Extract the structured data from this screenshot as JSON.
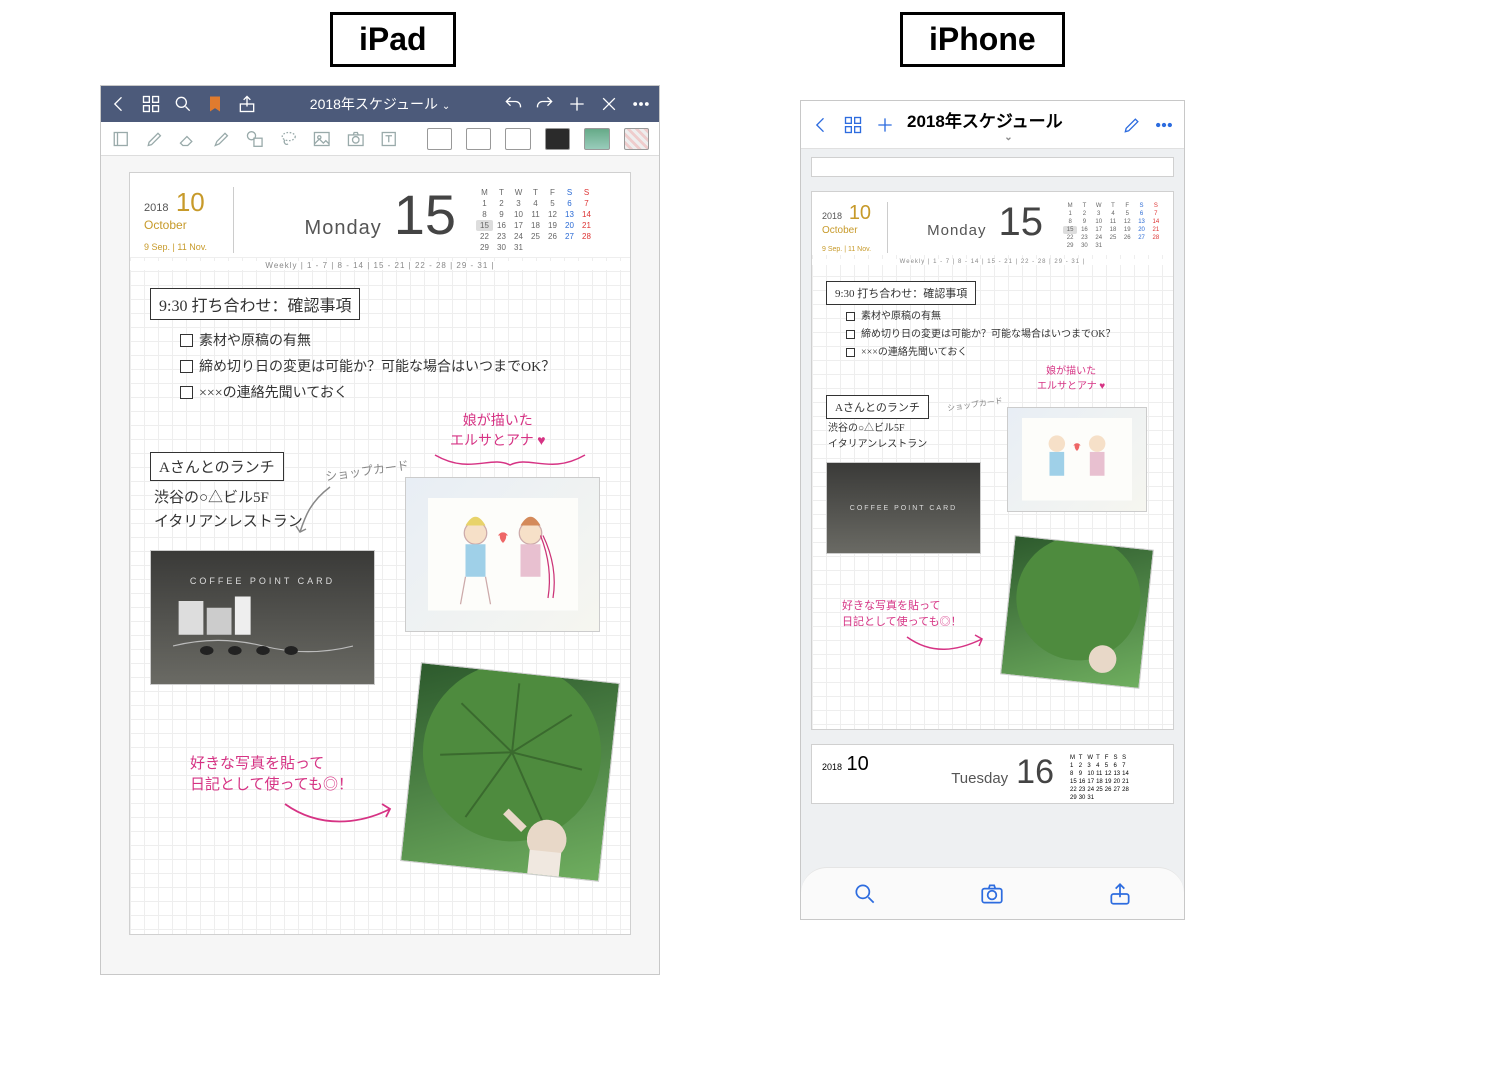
{
  "labels": {
    "ipad": "iPad",
    "iphone": "iPhone"
  },
  "doc_title": "2018年スケジュール",
  "planner": {
    "year": "2018",
    "month_num": "10",
    "month_name": "October",
    "prev_month": "9 Sep.",
    "next_month": "11 Nov.",
    "day_of_week": "Monday",
    "day_num": "15",
    "weekly_line": "Weekly | 1 - 7 | 8 - 14 | 15 - 21 | 22 - 28 | 29 - 31 |",
    "mini_header": [
      "M",
      "T",
      "W",
      "T",
      "F",
      "S",
      "S"
    ],
    "mini_rows": [
      [
        "1",
        "2",
        "3",
        "4",
        "5",
        "6",
        "7"
      ],
      [
        "8",
        "9",
        "10",
        "11",
        "12",
        "13",
        "14"
      ],
      [
        "15",
        "16",
        "17",
        "18",
        "19",
        "20",
        "21"
      ],
      [
        "22",
        "23",
        "24",
        "25",
        "26",
        "27",
        "28"
      ],
      [
        "29",
        "30",
        "31",
        "",
        "",
        "",
        ""
      ]
    ],
    "today_cell": "15",
    "next_day_of_week": "Tuesday",
    "next_day_num": "16"
  },
  "notes": {
    "meeting_title": "9:30 打ち合わせ：確認事項",
    "check1": "素材や原稿の有無",
    "check2": "締め切り日の変更は可能か？可能な場合はいつまでOK？",
    "check3": "×××の連絡先聞いておく",
    "lunch_title": "Aさんとのランチ",
    "lunch_line1": "渋谷の○△ビル5F",
    "lunch_line2": "イタリアンレストラン",
    "shop_card_note": "ショップカード",
    "drawing_note1": "娘が描いた",
    "drawing_note2": "エルサとアナ ♥",
    "photo_note1": "好きな写真を貼って",
    "photo_note2": "日記として使っても◎！",
    "coffee_card_label": "COFFEE POINT CARD"
  }
}
